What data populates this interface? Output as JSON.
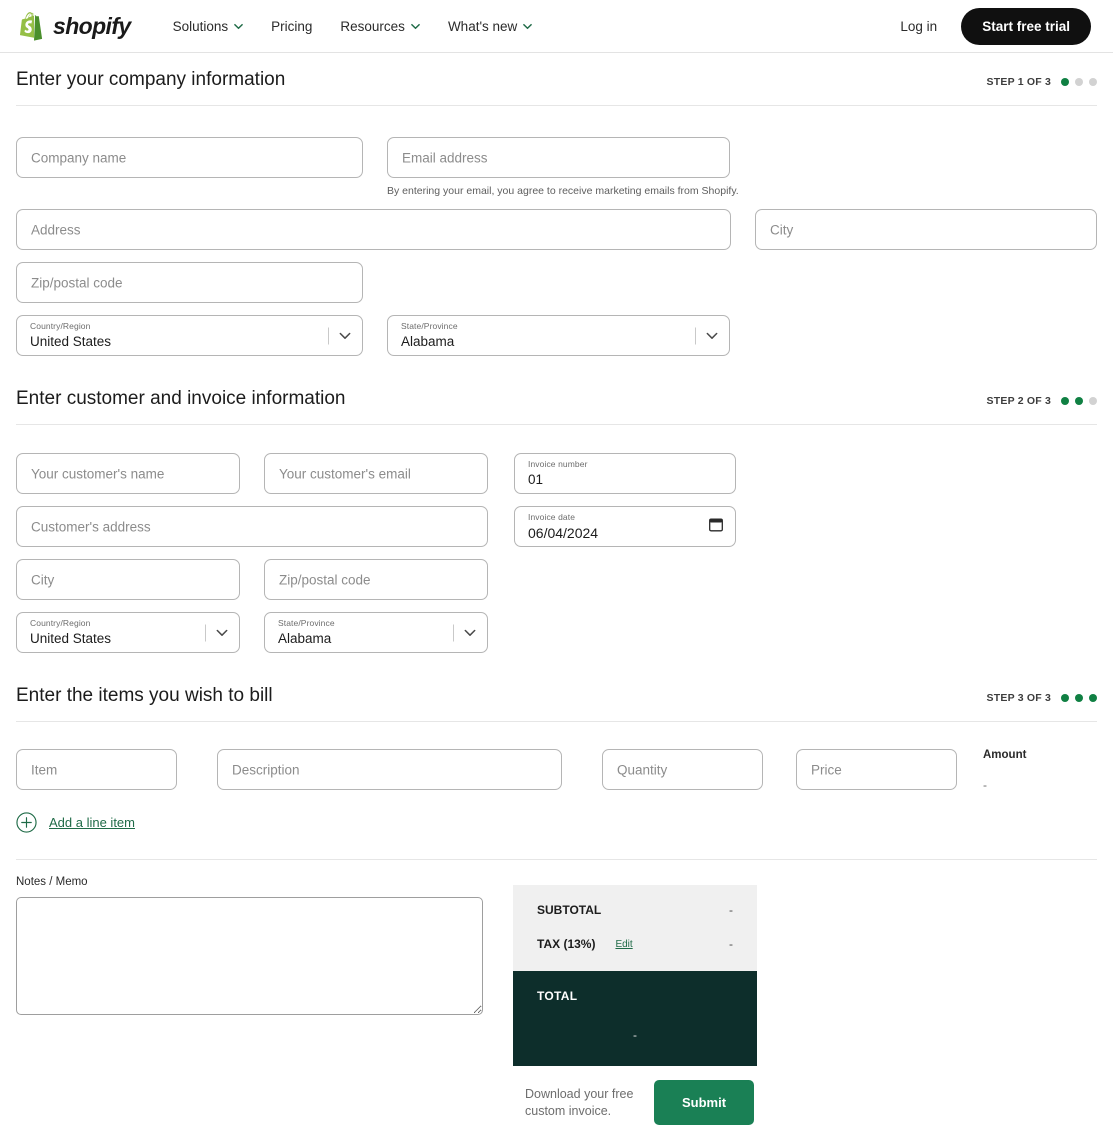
{
  "header": {
    "brand": "shopify",
    "nav": [
      {
        "label": "Solutions",
        "has_caret": true
      },
      {
        "label": "Pricing",
        "has_caret": false
      },
      {
        "label": "Resources",
        "has_caret": true
      },
      {
        "label": "What's new",
        "has_caret": true
      }
    ],
    "login": "Log in",
    "cta": "Start free trial"
  },
  "colors": {
    "accent_green": "#108043",
    "button_green": "#1a8055",
    "total_dark": "#0d2e2b",
    "link_green": "#1f6b47",
    "cta_black": "#101010"
  },
  "step1": {
    "title": "Enter your company information",
    "step_label": "STEP 1 OF 3",
    "dots_on": 1,
    "dots_total": 3,
    "company_name_placeholder": "Company name",
    "company_name_value": "",
    "email_placeholder": "Email address",
    "email_value": "",
    "email_helper": "By entering your email, you agree to receive marketing emails from Shopify.",
    "address_placeholder": "Address",
    "address_value": "",
    "city_placeholder": "City",
    "city_value": "",
    "zip_placeholder": "Zip/postal code",
    "zip_value": "",
    "country_label": "Country/Region",
    "country_value": "United States",
    "state_label": "State/Province",
    "state_value": "Alabama"
  },
  "step2": {
    "title": "Enter customer and invoice information",
    "step_label": "STEP 2 OF 3",
    "dots_on": 2,
    "dots_total": 3,
    "customer_name_placeholder": "Your customer's name",
    "customer_name_value": "",
    "customer_email_placeholder": "Your customer's email",
    "customer_email_value": "",
    "customer_address_placeholder": "Customer's address",
    "customer_address_value": "",
    "customer_city_placeholder": "City",
    "customer_city_value": "",
    "customer_zip_placeholder": "Zip/postal code",
    "customer_zip_value": "",
    "country_label": "Country/Region",
    "country_value": "United States",
    "state_label": "State/Province",
    "state_value": "Alabama",
    "invoice_number_label": "Invoice number",
    "invoice_number_value": "01",
    "invoice_date_label": "Invoice date",
    "invoice_date_value": "06/04/2024"
  },
  "step3": {
    "title": "Enter the items you wish to bill",
    "step_label": "STEP 3 OF 3",
    "dots_on": 3,
    "dots_total": 3,
    "item_placeholder": "Item",
    "item_value": "",
    "description_placeholder": "Description",
    "description_value": "",
    "quantity_placeholder": "Quantity",
    "quantity_value": "",
    "price_placeholder": "Price",
    "price_value": "",
    "amount_label": "Amount",
    "amount_value": "-",
    "add_line_item": "Add a line item"
  },
  "notes": {
    "label": "Notes / Memo",
    "value": "",
    "placeholder": ""
  },
  "totals": {
    "subtotal_label": "SUBTOTAL",
    "subtotal_value": "-",
    "tax_label": "TAX (13%)",
    "tax_edit": "Edit",
    "tax_value": "-",
    "total_label": "TOTAL",
    "total_value": "-"
  },
  "submit": {
    "note": "Download your free custom invoice.",
    "button": "Submit"
  }
}
